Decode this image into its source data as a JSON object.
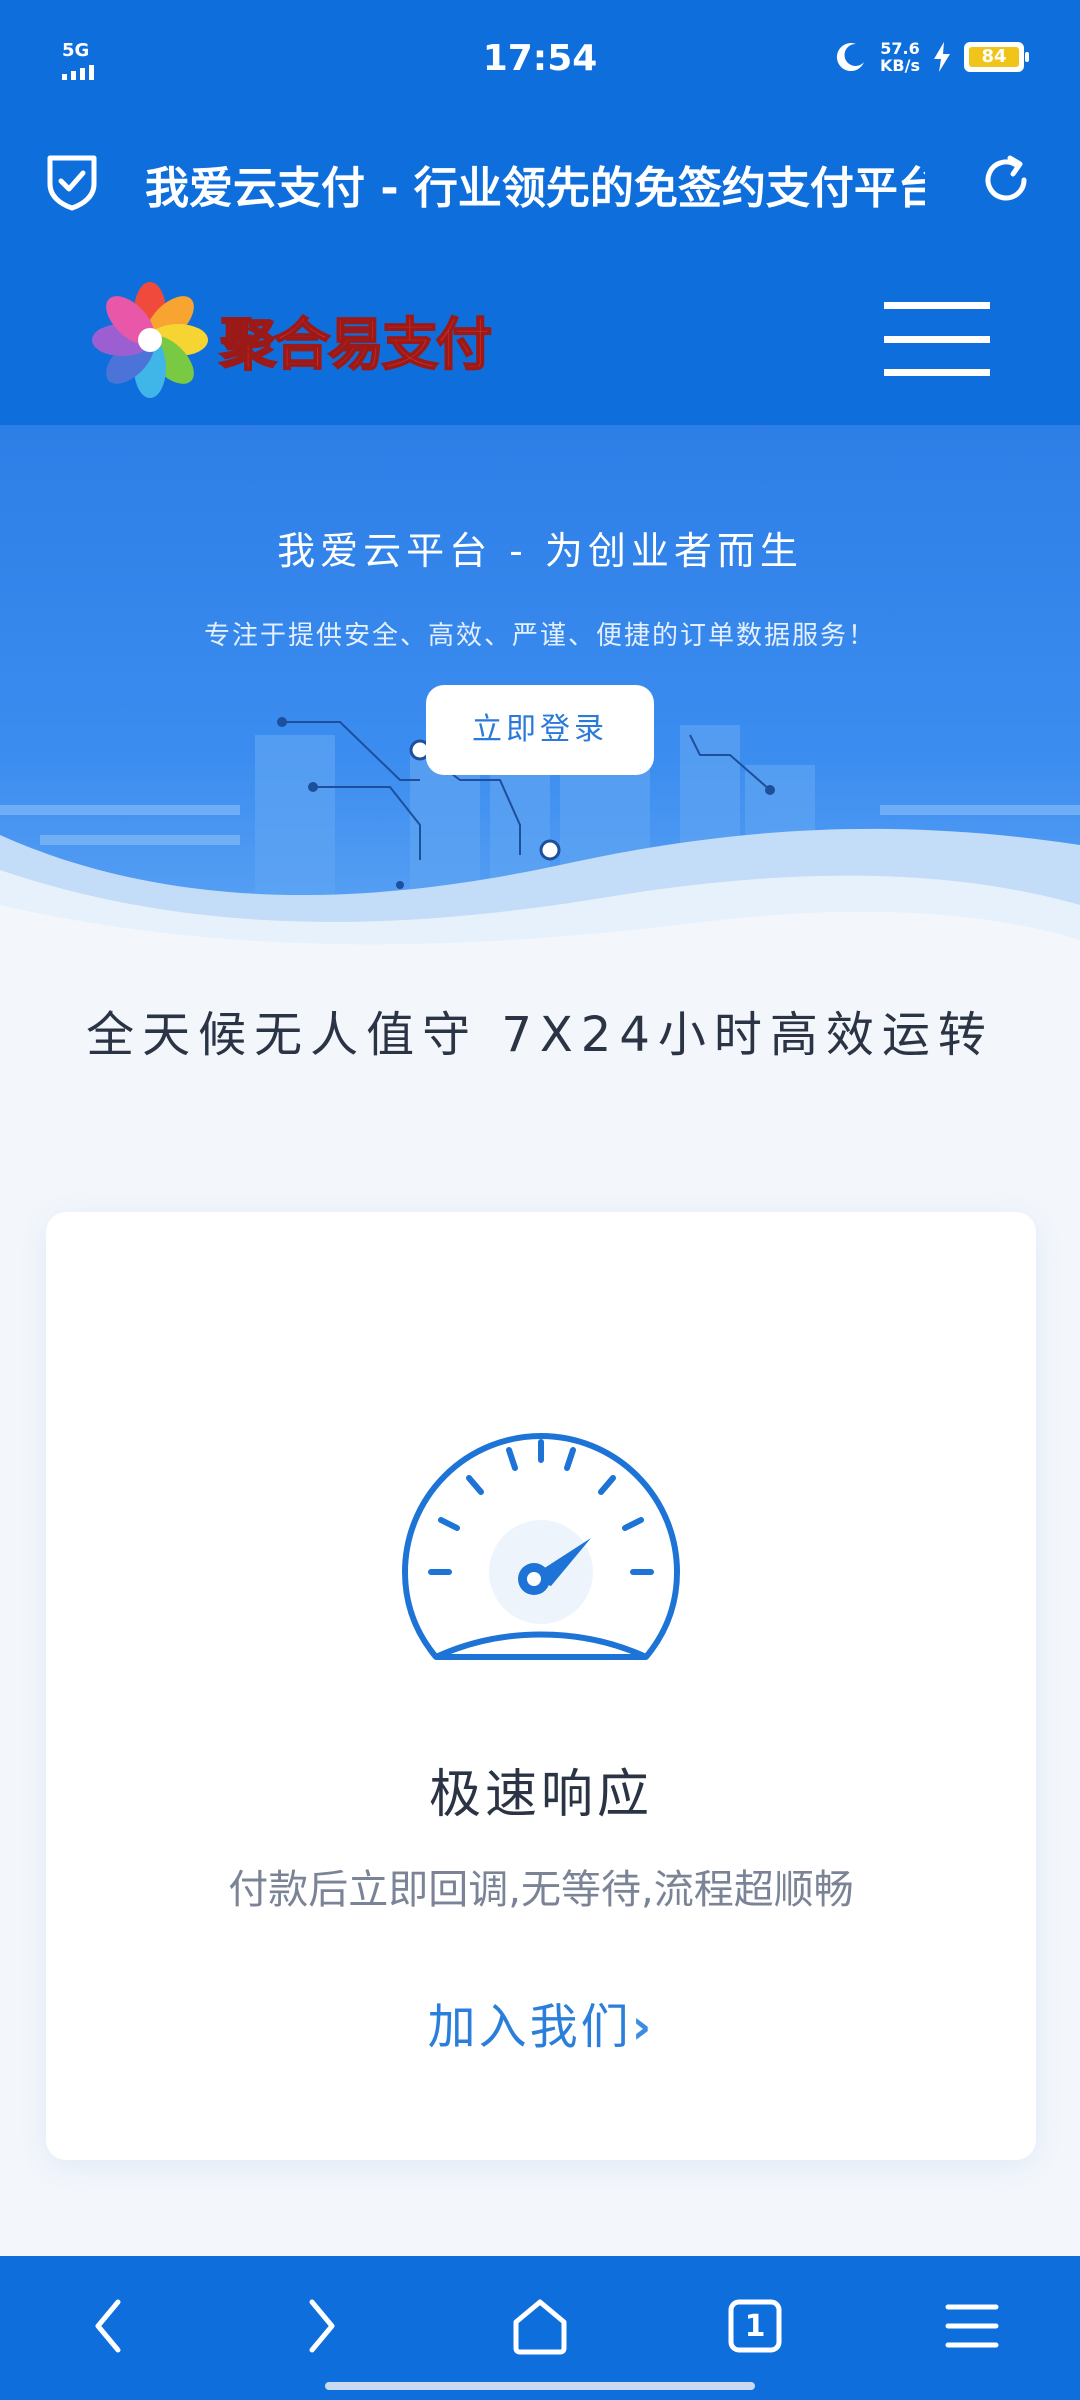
{
  "status_bar": {
    "network": "5G",
    "time": "17:54",
    "speed_value": "57.6",
    "speed_unit": "KB/s",
    "battery": "84"
  },
  "browser": {
    "page_title": "我爱云支付 - 行业领先的免签约支付平台",
    "tab_count": "1"
  },
  "site": {
    "logo_text": "聚合易支付"
  },
  "hero": {
    "title": "我爱云平台 - 为创业者而生",
    "subtitle": "专注于提供安全、高效、严谨、便捷的订单数据服务！",
    "login_button": "立即登录"
  },
  "tagline": "全天候无人值守 7X24小时高效运转",
  "feature_card": {
    "title": "极速响应",
    "description": "付款后立即回调,无等待,流程超顺畅",
    "link_label": "加入我们"
  },
  "colors": {
    "brand_blue": "#0e6fdc",
    "link_blue": "#2b7fdb",
    "logo_red": "#e8302c"
  }
}
